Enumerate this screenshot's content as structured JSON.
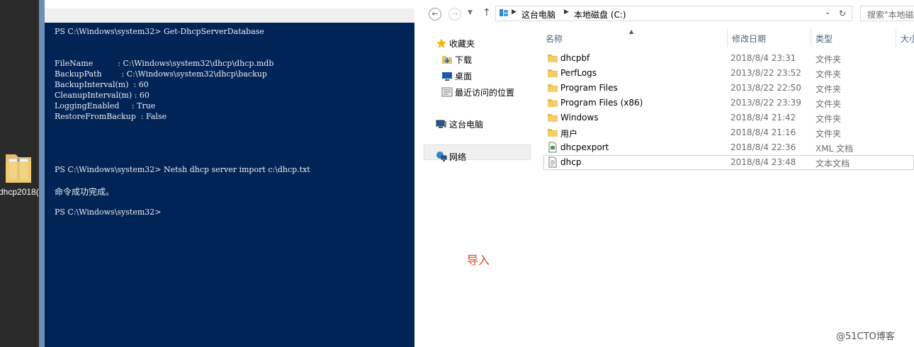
{
  "desktop": {
    "icon_label": "dhcp2018("
  },
  "powershell": {
    "lines": [
      "PS C:\\Windows\\system32> Get-DhcpServerDatabase",
      "FileName          : C:\\Windows\\system32\\dhcp\\dhcp.mdb",
      "BackupPath        : C:\\Windows\\system32\\dhcp\\backup",
      "BackupInterval(m)  : 60",
      "CleanupInterval(m) : 60",
      "LoggingEnabled     : True",
      "RestoreFromBackup  : False",
      "PS C:\\Windows\\system32> Netsh dhcp server import c:\\dhcp.txt",
      "命令成功完成。",
      "PS C:\\Windows\\system32>"
    ]
  },
  "explorer": {
    "address": {
      "part1": "这台电脑",
      "part2": "本地磁盘 (C:)"
    },
    "search_placeholder": "搜索\"本地磁",
    "nav": {
      "favorites": "收藏夹",
      "downloads": "下载",
      "desktop": "桌面",
      "recent": "最近访问的位置",
      "this_pc": "这台电脑",
      "network": "网络"
    },
    "columns": {
      "name": "名称",
      "date": "修改日期",
      "type": "类型",
      "size": "大小"
    },
    "files": [
      {
        "name": "dhcpbf",
        "date": "2018/8/4 23:31",
        "type": "文件夹",
        "icon": "folder-icon"
      },
      {
        "name": "PerfLogs",
        "date": "2013/8/22 23:52",
        "type": "文件夹",
        "icon": "folder-icon"
      },
      {
        "name": "Program Files",
        "date": "2013/8/22 22:50",
        "type": "文件夹",
        "icon": "folder-icon"
      },
      {
        "name": "Program Files (x86)",
        "date": "2013/8/22 23:39",
        "type": "文件夹",
        "icon": "folder-icon"
      },
      {
        "name": "Windows",
        "date": "2018/8/4 21:42",
        "type": "文件夹",
        "icon": "folder-icon"
      },
      {
        "name": "用户",
        "date": "2018/8/4 21:16",
        "type": "文件夹",
        "icon": "folder-icon"
      },
      {
        "name": "dhcpexport",
        "date": "2018/8/4 22:36",
        "type": "XML 文档",
        "icon": "xml-file-icon"
      },
      {
        "name": "dhcp",
        "date": "2018/8/4 23:48",
        "type": "文本文档",
        "icon": "text-file-icon"
      }
    ]
  },
  "annotation": "导入",
  "watermark": "@51CTO博客"
}
